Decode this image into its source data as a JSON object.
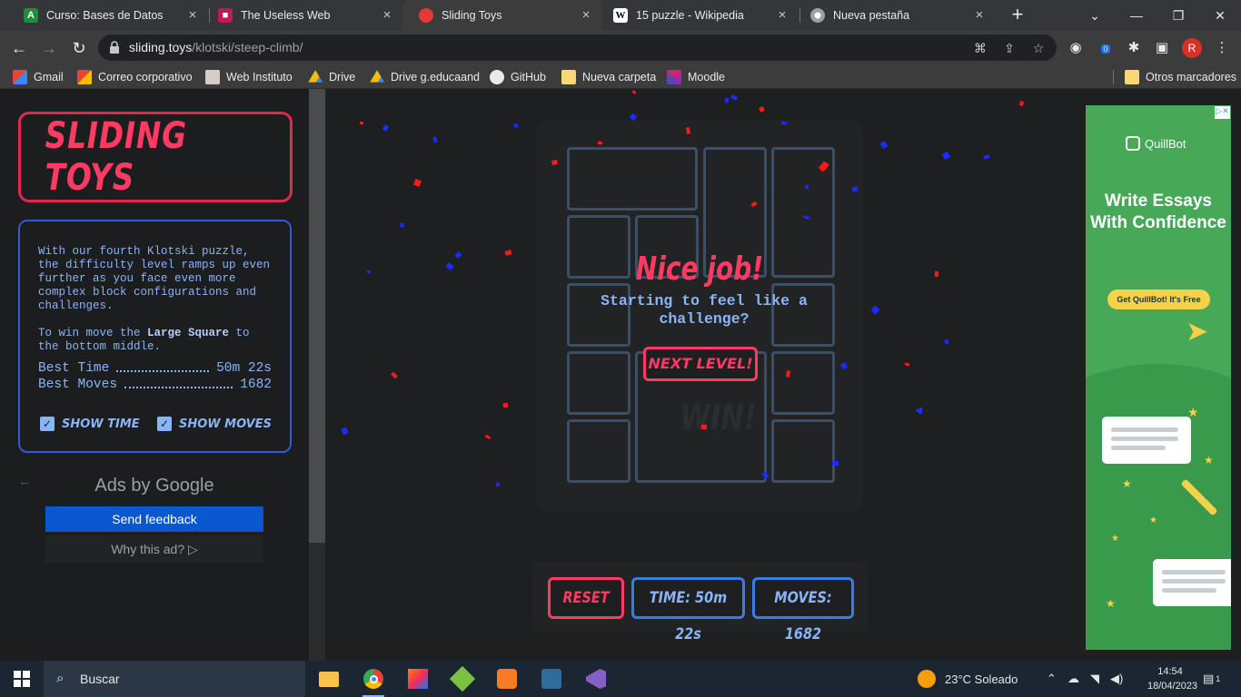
{
  "browser": {
    "tabs": [
      {
        "title": "Curso: Bases de Datos",
        "favicon": "green-a-icon",
        "active": false
      },
      {
        "title": "The Useless Web",
        "favicon": "pink-square-icon",
        "active": false
      },
      {
        "title": "Sliding Toys",
        "favicon": "tomato-icon",
        "active": true
      },
      {
        "title": "15 puzzle - Wikipedia",
        "favicon": "wikipedia-icon",
        "active": false
      },
      {
        "title": "Nueva pestaña",
        "favicon": "chrome-icon",
        "active": false
      }
    ],
    "url_host": "sliding.toys",
    "url_path": "/klotski/steep-climb/",
    "profile_initial": "R",
    "extension_badge": "0",
    "bookmarks": [
      {
        "label": "Gmail",
        "icon": "gmail-icon"
      },
      {
        "label": "Correo corporativo",
        "icon": "gmail-icon"
      },
      {
        "label": "Web Instituto",
        "icon": "school-icon"
      },
      {
        "label": "Drive",
        "icon": "drive-icon"
      },
      {
        "label": "Drive g.educaand",
        "icon": "drive-icon"
      },
      {
        "label": "GitHub",
        "icon": "github-icon"
      },
      {
        "label": "Nueva carpeta",
        "icon": "folder-icon"
      },
      {
        "label": "Moodle",
        "icon": "moodle-icon"
      }
    ],
    "other_bookmarks": "Otros marcadores"
  },
  "sidebar": {
    "logo": "SLIDING TOYS",
    "description": "With our fourth Klotski puzzle, the difficulty level ramps up even further as you face even more complex block configurations and challenges.",
    "goal_prefix": "To win move the ",
    "goal_bold": "Large Square",
    "goal_suffix": " to the bottom middle.",
    "best_time_label": "Best Time",
    "best_time_value": "50m 22s",
    "best_moves_label": "Best Moves",
    "best_moves_value": "1682",
    "show_time_label": "SHOW TIME",
    "show_moves_label": "SHOW MOVES",
    "show_time_checked": true,
    "show_moves_checked": true
  },
  "ads": {
    "ads_by": "Ads by Google",
    "send_feedback": "Send feedback",
    "why_this_ad": "Why this ad? ▷"
  },
  "game": {
    "win_title": "Nice job!",
    "win_subtitle": "Starting to feel like a challenge?",
    "next_level": "NEXT LEVEL!",
    "win_ghost": "WIN!",
    "reset": "RESET",
    "time": "TIME: 50m 22s",
    "moves": "MOVES: 1682"
  },
  "banner_ad": {
    "brand": "QuillBot",
    "headline": "Write Essays With Confidence",
    "cta": "Get QuillBot!  It's Free"
  },
  "taskbar": {
    "search_placeholder": "Buscar",
    "weather": "23°C  Soleado",
    "time": "14:54",
    "date": "18/04/2023",
    "notifications": "1"
  },
  "colors": {
    "accent_pink": "#ff3b63",
    "accent_blue": "#8ab4f8",
    "feedback_blue": "#0b57d0",
    "ad_green": "#3a9a4b"
  }
}
